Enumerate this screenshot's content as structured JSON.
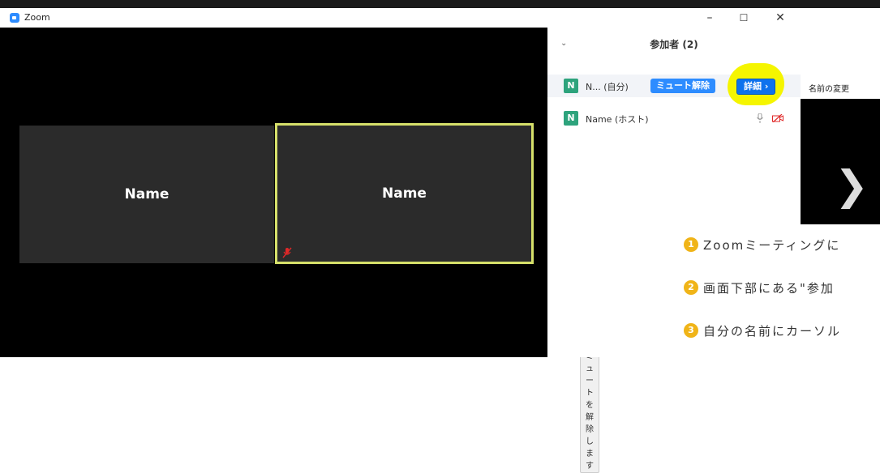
{
  "window": {
    "title": "Zoom",
    "minimize": "–",
    "maximize": "☐",
    "close": "✕"
  },
  "video": {
    "tiles": [
      {
        "name": "Name"
      },
      {
        "name": "Name"
      }
    ],
    "prev_arrow": "❮",
    "next_arrow": "❯",
    "tooltip": "ミュートを解除します"
  },
  "participants": {
    "collapse": "⌄",
    "title": "参加者 (2)",
    "rows": [
      {
        "avatar": "N",
        "name": "N... (自分)",
        "unmute_label": "ミュート解除",
        "more_label": "詳細 ›"
      },
      {
        "avatar": "N",
        "name": "Name (ホスト)"
      }
    ]
  },
  "context_menu": {
    "rename": "名前の変更"
  },
  "steps": [
    {
      "num": "1",
      "text": "Zoomミーティングに"
    },
    {
      "num": "2",
      "text": "画面下部にある\"参加"
    },
    {
      "num": "3",
      "text": "自分の名前にカーソル"
    }
  ],
  "colors": {
    "accent": "#2d8cff",
    "highlight": "#f5f500",
    "avatar": "#2da37c",
    "active_border": "#d6e06a",
    "muted": "#e02828"
  }
}
